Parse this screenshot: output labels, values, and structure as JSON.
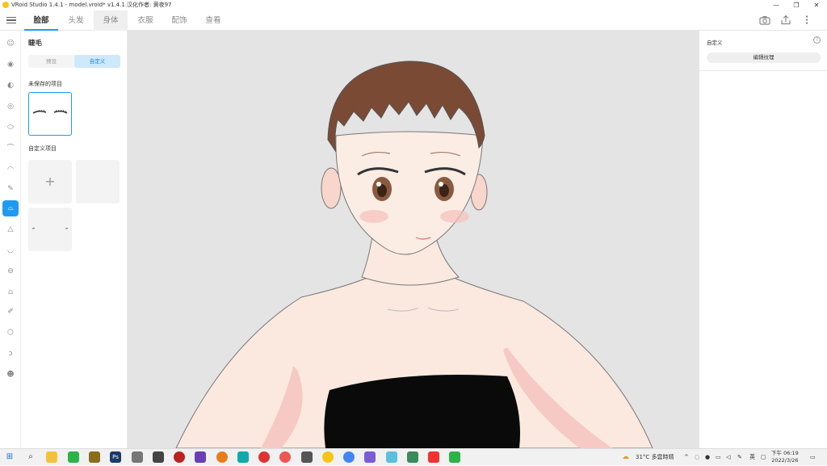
{
  "window": {
    "title": "VRoid Studio 1.4.1 - model.vroid* v1.4.1 汉化作者: 黄夜97",
    "minimize": "—",
    "restore": "❐",
    "close": "✕"
  },
  "tabs": [
    {
      "label": "脸部"
    },
    {
      "label": "头发"
    },
    {
      "label": "身体"
    },
    {
      "label": "衣服"
    },
    {
      "label": "配饰"
    },
    {
      "label": "查看"
    }
  ],
  "toolbar_icons": [
    "camera-icon",
    "export-icon",
    "more-icon"
  ],
  "left_panel": {
    "title": "睫毛",
    "segment": {
      "preset": "预设",
      "custom": "自定义"
    },
    "unsaved_label": "未保存的项目",
    "custom_label": "自定义项目",
    "add_symbol": "+"
  },
  "right_panel": {
    "title": "自定义",
    "help": "?",
    "edit_texture_button": "编辑纹理"
  },
  "taskbar": {
    "weather": "31°C 多雲時晴",
    "ime": "英",
    "time": "下午 06:19",
    "date": "2022/3/26"
  },
  "colors": {
    "accent": "#1e9bf0",
    "hair": "#7a4a35",
    "skin": "#fbe9df",
    "dress": "#0a0a0a",
    "viewport_bg": "#e4e4e4"
  }
}
